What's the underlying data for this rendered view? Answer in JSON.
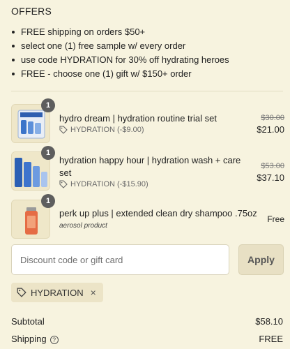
{
  "offers": {
    "title": "OFFERS",
    "items": [
      "FREE shipping on orders $50+",
      "select one (1) free sample w/ every order",
      "use code HYDRATION for 30% off hydrating heroes",
      "FREE - choose one (1) gift w/ $150+ order"
    ]
  },
  "cart": {
    "items": [
      {
        "quantity": "1",
        "name": "hydro dream | hydration routine trial set",
        "discount": "HYDRATION (-$9.00)",
        "original_price": "$30.00",
        "price": "$21.00"
      },
      {
        "quantity": "1",
        "name_line1": "hydration happy hour | hydration wash + care",
        "name_line2": "set",
        "discount": "HYDRATION (-$15.90)",
        "original_price": "$53.00",
        "price": "$37.10"
      },
      {
        "quantity": "1",
        "name": "perk up plus | extended clean dry shampoo .75oz",
        "subtitle": "aerosol product",
        "price": "Free"
      }
    ]
  },
  "discount": {
    "placeholder": "Discount code or gift card",
    "apply_label": "Apply",
    "applied_code": "HYDRATION",
    "remove_label": "×"
  },
  "summary": {
    "subtotal_label": "Subtotal",
    "subtotal_value": "$58.10",
    "shipping_label": "Shipping",
    "shipping_value": "FREE"
  },
  "colors": {
    "background": "#f7f3df",
    "badge": "#5e5e5e",
    "apply_button": "#e8e0c4"
  }
}
